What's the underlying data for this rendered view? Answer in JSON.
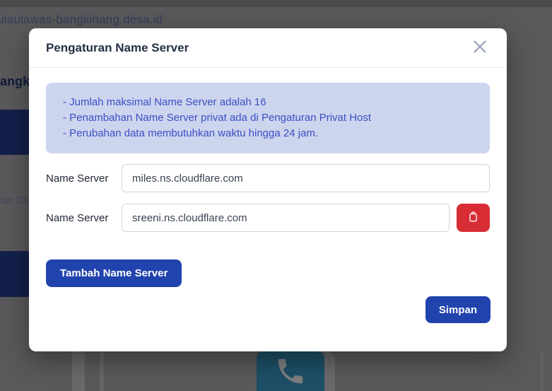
{
  "background": {
    "url_text": "ulaulawas-bangkinang.desa.id",
    "heading_fragment": "angki",
    "date_fragment": "ber 202"
  },
  "modal": {
    "title": "Pengaturan Name Server",
    "notice": {
      "lines": [
        "- Jumlah maksimal Name Server adalah 16",
        "- Penambahan Name Server privat ada di Pengaturan Privat Host",
        "- Perubahan data membutuhkan waktu hingga 24 jam."
      ]
    },
    "fields": [
      {
        "label": "Name Server",
        "value": "miles.ns.cloudflare.com"
      },
      {
        "label": "Name Server",
        "value": "sreeni.ns.cloudflare.com"
      }
    ],
    "add_button_label": "Tambah Name Server",
    "save_button_label": "Simpan"
  },
  "colors": {
    "primary_blue": "#2143ae",
    "danger_red": "#d92d35",
    "notice_bg": "#cdd4ee",
    "notice_text": "#3a50c4",
    "navy_block": "#13204a",
    "teal_phone_box": "#1d4f66"
  }
}
